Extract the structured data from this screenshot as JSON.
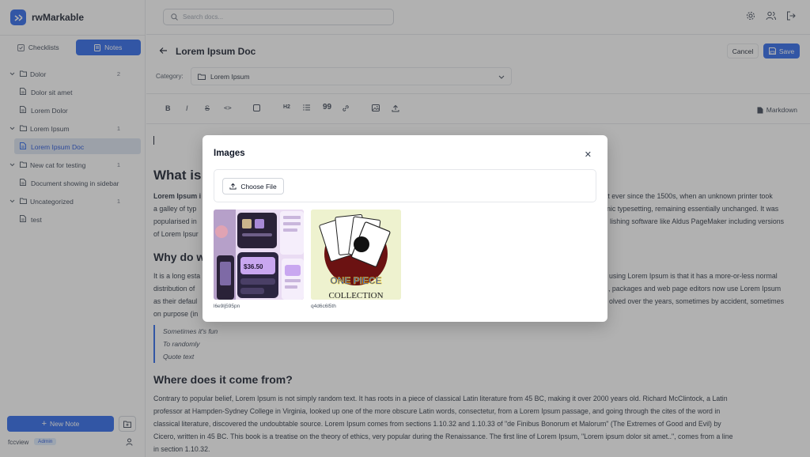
{
  "app": {
    "name": "rwMarkable"
  },
  "sidebar": {
    "tabs": [
      {
        "label": "Checklists"
      },
      {
        "label": "Notes"
      }
    ],
    "tree": [
      {
        "type": "folder",
        "label": "Dolor",
        "count": "2"
      },
      {
        "type": "doc",
        "label": "Dolor sit amet"
      },
      {
        "type": "doc",
        "label": "Lorem Dolor"
      },
      {
        "type": "folder",
        "label": "Lorem Ipsum",
        "count": "1"
      },
      {
        "type": "doc",
        "label": "Lorem Ipsum Doc",
        "selected": true
      },
      {
        "type": "folder",
        "label": "New cat for testing",
        "count": "1"
      },
      {
        "type": "doc",
        "label": "Document showing in sidebar"
      },
      {
        "type": "folder",
        "label": "Uncategorized",
        "count": "1"
      },
      {
        "type": "doc",
        "label": "test"
      }
    ],
    "new_note_label": "New Note",
    "user": {
      "name": "fccview",
      "role": "Admin"
    }
  },
  "topbar": {
    "search_placeholder": "Search docs..."
  },
  "doc": {
    "title": "Lorem Ipsum Doc",
    "cancel_label": "Cancel",
    "save_label": "Save",
    "category_label": "Category:",
    "category_value": "Lorem Ipsum",
    "markdown_label": "Markdown"
  },
  "toolbar": {
    "items": [
      "B",
      "I",
      "S",
      "<>",
      "",
      "H2",
      "",
      "99",
      "",
      "",
      ""
    ]
  },
  "content": {
    "h1": "What is",
    "p1_line1_left": "Lorem Ipsum i",
    "p1_line1_right": "xt ever since the 1500s, when an unknown printer took",
    "p1_line2_left": "a galley of typ",
    "p1_line2_right": "nic typesetting, remaining essentially unchanged. It was",
    "p1_line3_left": "popularised in",
    "p1_line3_right": "lishing software like Aldus PageMaker including versions",
    "p1_line4_left": "of Lorem Ipsur",
    "h2_why": "Why do w",
    "p2_line1_left": "It is a long esta",
    "p2_line1_right": "using Lorem Ipsum is that it has a more-or-less normal",
    "p2_line2_left": "distribution of",
    "p2_line2_right": ", packages and web page editors now use Lorem Ipsum",
    "p2_line3_left": "as their defaul",
    "p2_line3_right": "olved over the years, sometimes by accident, sometimes",
    "p2_line4_left": "on purpose (in",
    "quote": [
      "Sometimes it's fun",
      "To randomly",
      "Quote text"
    ],
    "h2_where": "Where does it come from?",
    "p3": [
      "Contrary to popular belief, Lorem Ipsum is not simply random text. It has roots in a piece of classical Latin literature from 45 BC, making it over 2000 years old. Richard McClintock, a Latin",
      "professor at Hampden-Sydney College in Virginia, looked up one of the more obscure Latin words, consectetur, from a Lorem Ipsum passage, and going through the cites of the word in",
      "classical literature, discovered the undoubtable source. Lorem Ipsum comes from sections 1.10.32 and 1.10.33 of \"de Finibus Bonorum et Malorum\" (The Extremes of Good and Evil) by",
      "Cicero, written in 45 BC. This book is a treatise on the theory of ethics, very popular during the Renaissance. The first line of Lorem Ipsum, \"Lorem ipsum dolor sit amet..\", comes from a line",
      "in section 1.10.32."
    ]
  },
  "modal": {
    "title": "Images",
    "choose_file_label": "Choose File",
    "images": [
      {
        "caption": "l6e9lj595pn"
      },
      {
        "caption": "q4d6c6l5th"
      }
    ],
    "thumb2_text": "ONE PIECE",
    "thumb2_sub": "COLLECTION",
    "thumb1_price": "$36.50"
  },
  "colors": {
    "accent": "#2563eb",
    "overlay": "rgba(70,70,70,0.42)"
  }
}
